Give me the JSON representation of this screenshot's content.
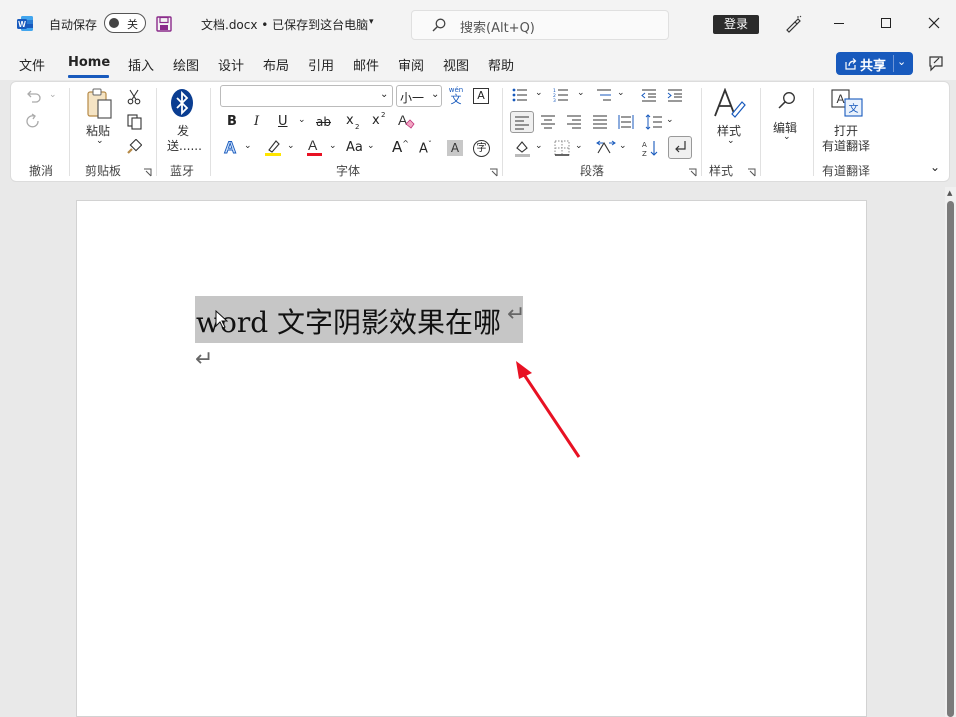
{
  "titlebar": {
    "autosave_label": "自动保存",
    "autosave_state": "关",
    "doc_title": "文档.docx • 已保存到这台电脑",
    "search_placeholder": "搜索(Alt+Q)",
    "login_label": "登录"
  },
  "menu": {
    "tabs": [
      "文件",
      "Home",
      "插入",
      "绘图",
      "设计",
      "布局",
      "引用",
      "邮件",
      "审阅",
      "视图",
      "帮助"
    ],
    "share_label": "共享"
  },
  "ribbon": {
    "groups": {
      "undo": "撤消",
      "clipboard": "剪贴板",
      "bluetooth": "蓝牙",
      "font": "字体",
      "paragraph": "段落",
      "styles": "样式",
      "youdao": "有道翻译"
    },
    "paste_label": "粘贴",
    "send_label_1": "发",
    "send_label_2": "送......",
    "font_size": "小一",
    "styles_label": "样式",
    "edit_label": "编辑",
    "open_label": "打开",
    "youdao_label": "有道翻译",
    "phonetic_top": "wén",
    "phonetic_bottom": "文",
    "aa_label": "Aa",
    "bold": "B",
    "italic": "I",
    "underline": "U",
    "strike": "ab",
    "sub": "x",
    "sup": "x"
  },
  "document": {
    "line1": "word 文字阴影效果在哪",
    "paragraph_mark": "↵"
  },
  "colors": {
    "accent": "#185abd",
    "highlight": "#c6c6c6",
    "arrow": "#e81123"
  }
}
